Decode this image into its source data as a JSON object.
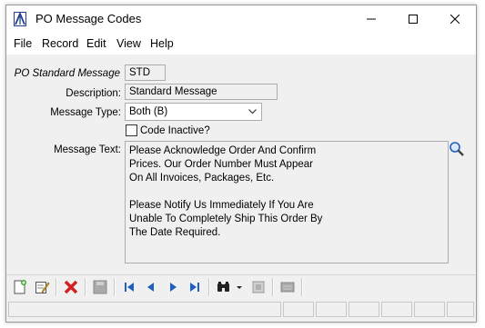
{
  "window": {
    "title": "PO Message Codes"
  },
  "menu": {
    "items": [
      "File",
      "Record",
      "Edit",
      "View",
      "Help"
    ]
  },
  "form": {
    "po_standard_message_label": "PO Standard Message",
    "po_standard_message_value": "STD",
    "description_label": "Description:",
    "description_value": "Standard Message",
    "message_type_label": "Message Type:",
    "message_type_value": "Both (B)",
    "code_inactive_label": "Code Inactive?",
    "code_inactive_checked": false,
    "message_text_label": "Message Text:",
    "message_text_value": "Please Acknowledge Order And Confirm\nPrices. Our Order Number Must Appear\nOn All Invoices, Packages, Etc.\n\nPlease Notify Us Immediately If You Are\nUnable To Completely Ship This Order By\nThe Date Required."
  },
  "toolbar": {
    "buttons": [
      "new-record",
      "edit-record",
      "delete-record",
      "save-record",
      "first-record",
      "previous-record",
      "next-record",
      "last-record",
      "find",
      "lookup",
      "notes"
    ]
  },
  "colors": {
    "accent": "#1f5fbf",
    "delete": "#d42020"
  }
}
